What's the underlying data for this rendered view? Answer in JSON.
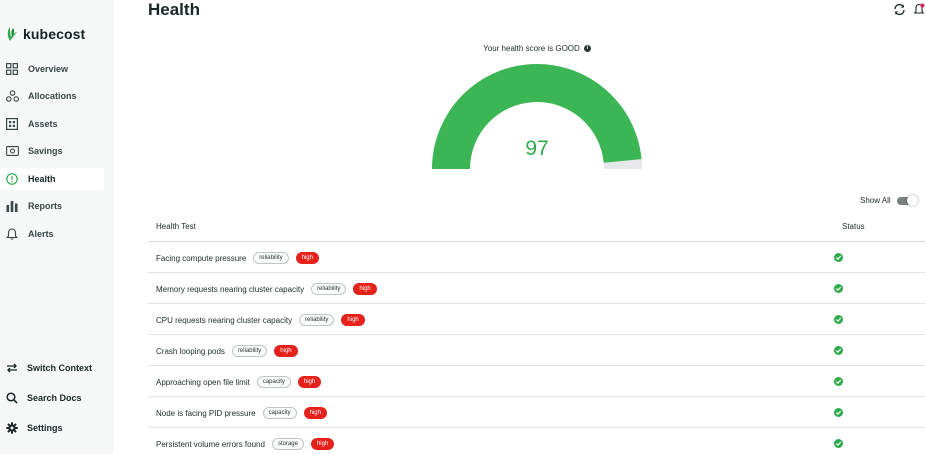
{
  "brand": {
    "name": "kubecost",
    "accent": "#2eab4c"
  },
  "sidebar": {
    "items": [
      {
        "label": "Overview",
        "icon": "grid-icon"
      },
      {
        "label": "Allocations",
        "icon": "nodes-icon"
      },
      {
        "label": "Assets",
        "icon": "assets-icon"
      },
      {
        "label": "Savings",
        "icon": "savings-icon"
      },
      {
        "label": "Health",
        "icon": "health-icon",
        "active": true
      },
      {
        "label": "Reports",
        "icon": "bar-chart-icon"
      },
      {
        "label": "Alerts",
        "icon": "bell-icon"
      }
    ],
    "bottom": [
      {
        "label": "Switch Context",
        "icon": "swap-icon"
      },
      {
        "label": "Search Docs",
        "icon": "search-icon"
      },
      {
        "label": "Settings",
        "icon": "gear-icon"
      }
    ]
  },
  "header": {
    "title": "Health"
  },
  "health": {
    "score_label": "Your health score is GOOD",
    "score": "97",
    "score_value": 97,
    "score_max": 100,
    "gauge_color": "#3cb554",
    "show_all_label": "Show All",
    "show_all_on": true
  },
  "table": {
    "columns": {
      "test": "Health Test",
      "status": "Status"
    },
    "rows": [
      {
        "name": "Facing compute pressure",
        "category": "reliability",
        "severity": "high",
        "status": "ok"
      },
      {
        "name": "Memory requests nearing cluster capacity",
        "category": "reliability",
        "severity": "high",
        "status": "ok"
      },
      {
        "name": "CPU requests nearing cluster capacity",
        "category": "reliability",
        "severity": "high",
        "status": "ok"
      },
      {
        "name": "Crash looping pods",
        "category": "reliability",
        "severity": "high",
        "status": "ok"
      },
      {
        "name": "Approaching open file limit",
        "category": "capacity",
        "severity": "high",
        "status": "ok"
      },
      {
        "name": "Node is facing PID pressure",
        "category": "capacity",
        "severity": "high",
        "status": "ok"
      },
      {
        "name": "Persistent volume errors found",
        "category": "storage",
        "severity": "high",
        "status": "ok"
      }
    ]
  }
}
